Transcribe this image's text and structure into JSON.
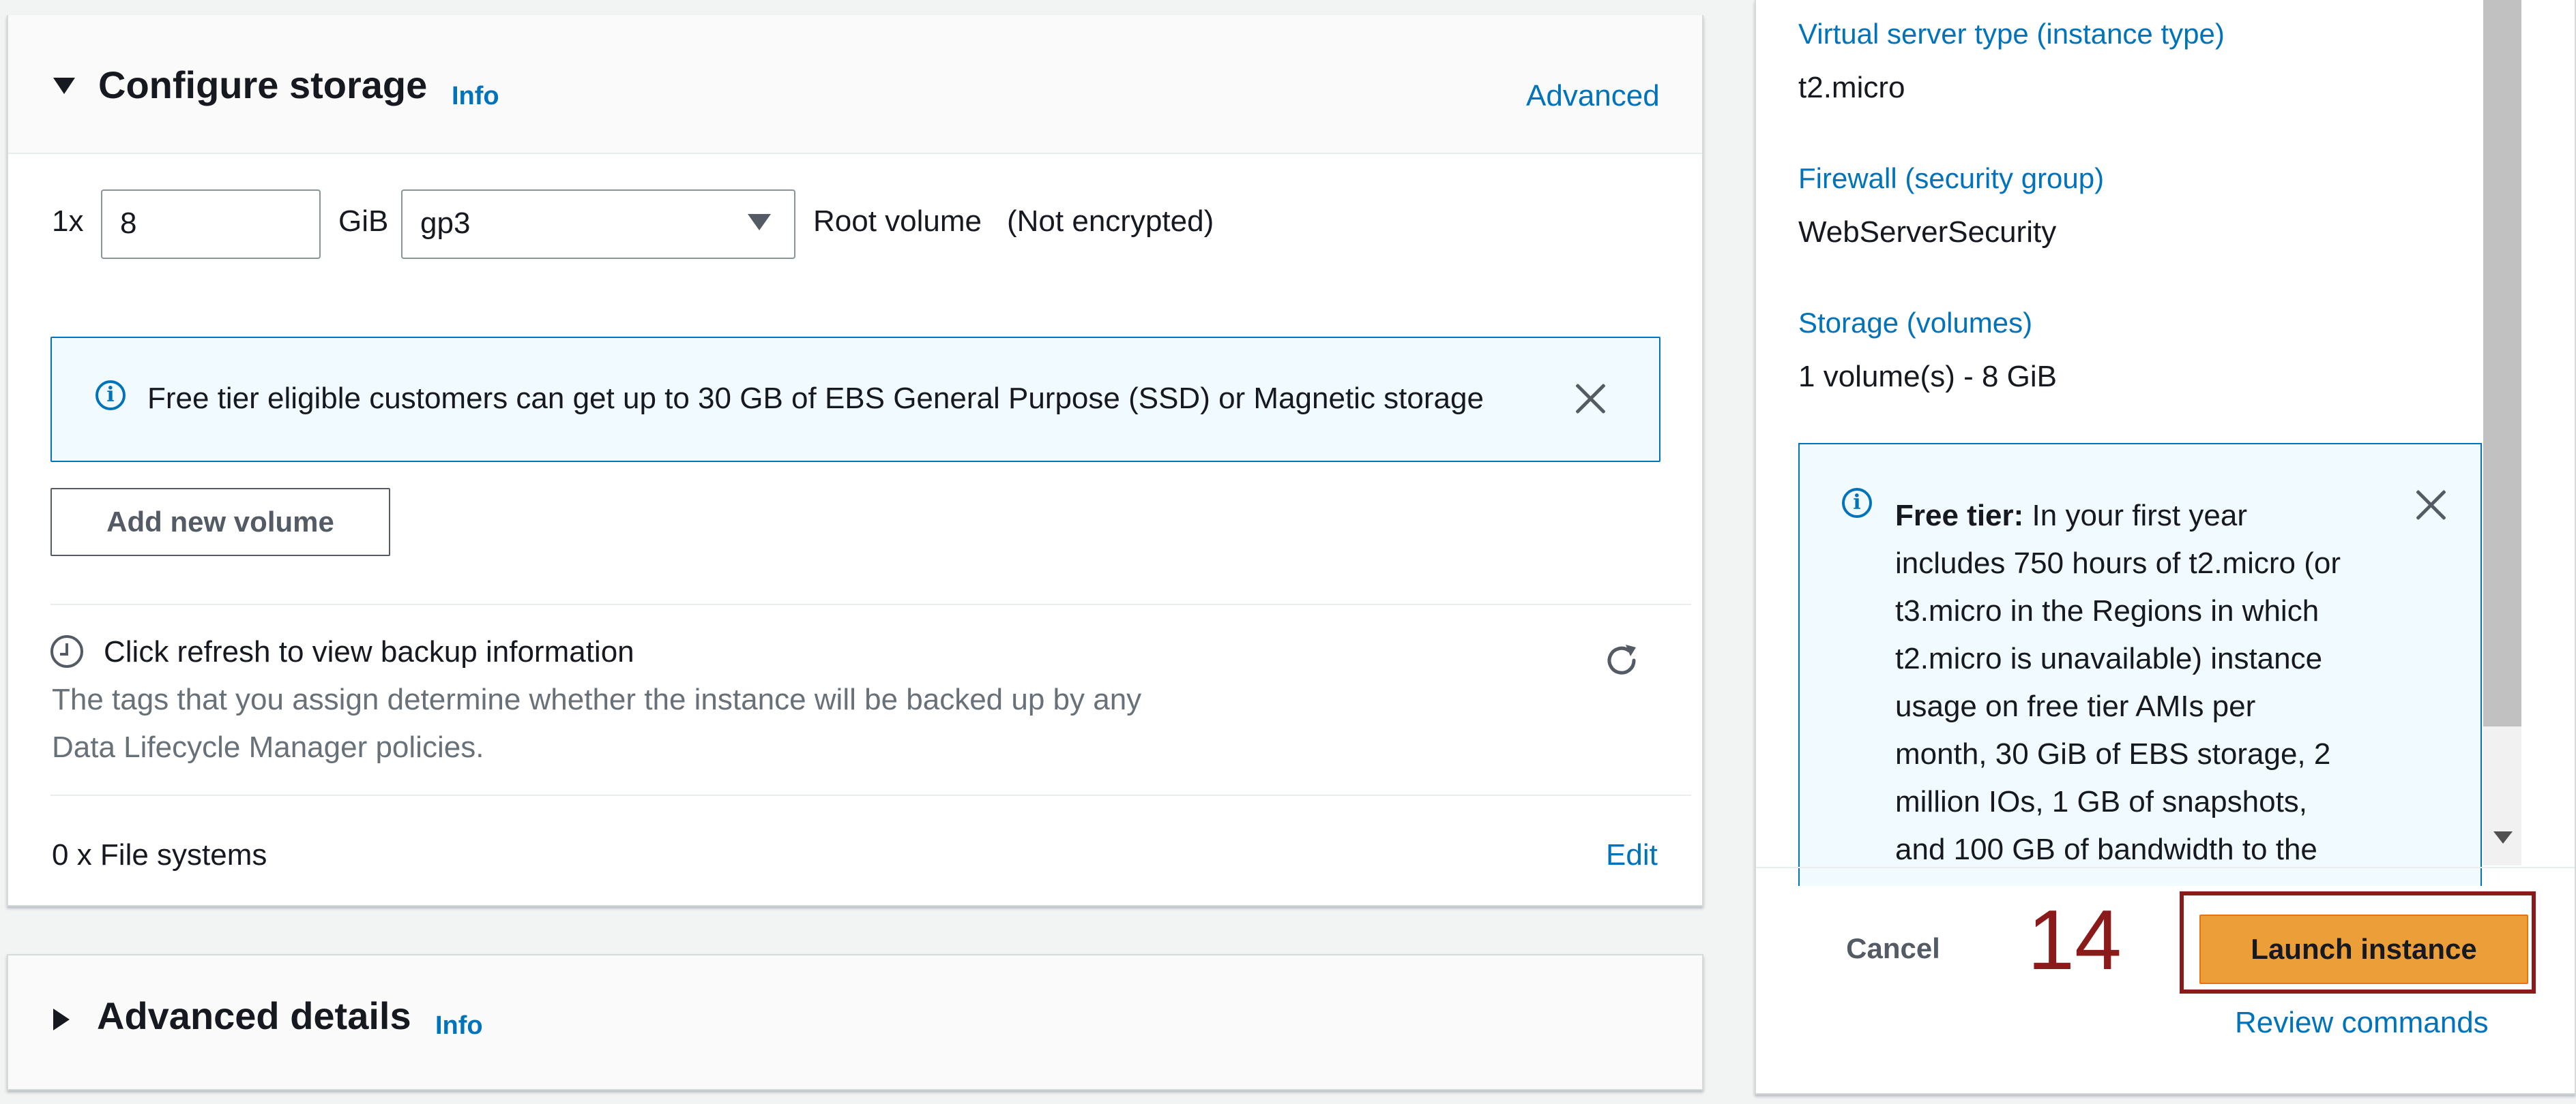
{
  "storage": {
    "title": "Configure storage",
    "info": "Info",
    "advanced_link": "Advanced",
    "volume_prefix": "1x",
    "size_value": "8",
    "size_unit": "GiB",
    "volume_type": "gp3",
    "root_label": "Root volume",
    "encryption_status": "(Not encrypted)",
    "free_tier_alert": "Free tier eligible customers can get up to 30 GB of EBS General Purpose (SSD) or Magnetic storage",
    "add_volume_button": "Add new volume",
    "backup_title": "Click refresh to view backup information",
    "backup_desc_line1": "The tags that you assign determine whether the instance will be backed up by any",
    "backup_desc_line2": "Data Lifecycle Manager policies.",
    "file_systems": "0 x File systems",
    "edit_link": "Edit"
  },
  "advanced_details": {
    "title": "Advanced details",
    "info": "Info"
  },
  "summary": {
    "instance_type_label": "Virtual server type (instance type)",
    "instance_type_value": "t2.micro",
    "firewall_label": "Firewall (security group)",
    "firewall_value": "WebServerSecurity",
    "storage_label": "Storage (volumes)",
    "storage_value": "1 volume(s) - 8 GiB",
    "free_tier_bold": "Free tier:",
    "free_tier_lines": [
      "In your first year",
      "includes 750 hours of t2.micro (or",
      "t3.micro in the Regions in which",
      "t2.micro is unavailable) instance",
      "usage on free tier AMIs per",
      "month, 30 GiB of EBS storage, 2",
      "million IOs, 1 GB of snapshots,",
      "and 100 GB of bandwidth to the"
    ],
    "cancel_button": "Cancel",
    "launch_button": "Launch instance",
    "review_link": "Review commands"
  },
  "annotation": {
    "step_number": "14"
  },
  "colors": {
    "link": "#0073bb",
    "primary_button": "#ec9f38",
    "highlight_box": "#8b1a1a",
    "alert_background": "#f1faff"
  }
}
